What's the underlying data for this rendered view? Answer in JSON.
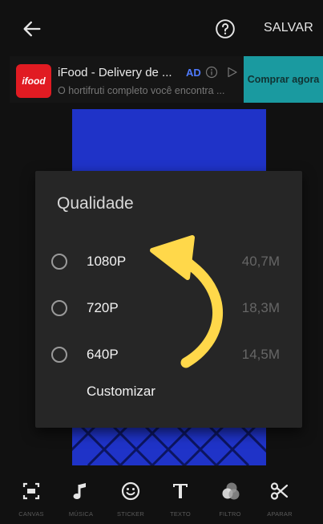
{
  "header": {
    "save_label": "SALVAR"
  },
  "ad": {
    "logo_text": "ifood",
    "title": "iFood - Delivery de ...",
    "badge": "AD",
    "subtitle": "O hortifruti completo você encontra ...",
    "cta": "Comprar agora"
  },
  "dialog": {
    "title": "Qualidade",
    "options": [
      {
        "label": "1080P",
        "size": "40,7M"
      },
      {
        "label": "720P",
        "size": "18,3M"
      },
      {
        "label": "640P",
        "size": "14,5M"
      }
    ],
    "custom_label": "Customizar"
  },
  "toolbar": [
    {
      "label": "CANVAS",
      "icon": "canvas-icon"
    },
    {
      "label": "MÚSICA",
      "icon": "music-note-icon"
    },
    {
      "label": "STICKER",
      "icon": "smiley-icon"
    },
    {
      "label": "TEXTO",
      "icon": "text-icon"
    },
    {
      "label": "FILTRO",
      "icon": "filter-icon"
    },
    {
      "label": "APARAR",
      "icon": "scissors-icon"
    }
  ],
  "colors": {
    "accent_cta": "#1a9aa0",
    "ad_badge": "#4f7bff",
    "canvas": "#1f33c8",
    "arrow": "#ffd84a",
    "ifood_red": "#e11b22"
  }
}
